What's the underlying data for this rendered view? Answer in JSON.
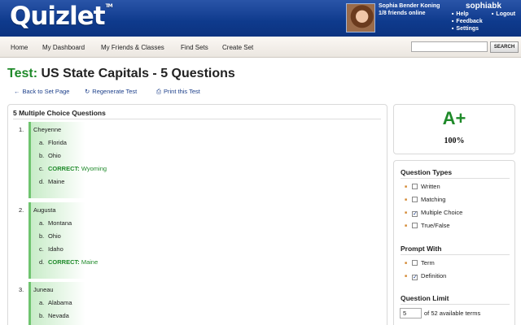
{
  "header": {
    "logo": "Quizlet",
    "tm": "TM",
    "user_full_name": "Sophia Bender Koning",
    "friends_online": "1/8 friends online",
    "username": "sophiabk",
    "links": {
      "help": "Help",
      "logout": "Logout",
      "feedback": "Feedback",
      "settings": "Settings"
    }
  },
  "nav": {
    "items": [
      "Home",
      "My Dashboard",
      "My Friends & Classes",
      "Find Sets",
      "Create Set"
    ],
    "search_value": "",
    "search_button": "SEARCH"
  },
  "page": {
    "title_prefix": "Test:",
    "title": "US State Capitals - 5 Questions",
    "actions": {
      "back": "Back to Set Page",
      "regenerate": "Regenerate Test",
      "print": "Print this Test"
    },
    "section_title": "5 Multiple Choice Questions",
    "questions": [
      {
        "num": "1.",
        "term": "Cheyenne",
        "options": [
          {
            "letter": "a.",
            "text": "Florida"
          },
          {
            "letter": "b.",
            "text": "Ohio"
          },
          {
            "letter": "c.",
            "prefix": "CORRECT:",
            "text": "Wyoming"
          },
          {
            "letter": "d.",
            "text": "Maine"
          }
        ]
      },
      {
        "num": "2.",
        "term": "Augusta",
        "options": [
          {
            "letter": "a.",
            "text": "Montana"
          },
          {
            "letter": "b.",
            "text": "Ohio"
          },
          {
            "letter": "c.",
            "text": "Idaho"
          },
          {
            "letter": "d.",
            "prefix": "CORRECT:",
            "text": "Maine"
          }
        ]
      },
      {
        "num": "3.",
        "term": "Juneau",
        "options": [
          {
            "letter": "a.",
            "text": "Alabama"
          },
          {
            "letter": "b.",
            "text": "Nevada"
          }
        ]
      }
    ]
  },
  "sidebar": {
    "grade": "A+",
    "percent": "100%",
    "question_types_title": "Question Types",
    "question_types": [
      {
        "label": "Written",
        "checked": false
      },
      {
        "label": "Matching",
        "checked": false
      },
      {
        "label": "Multiple Choice",
        "checked": true
      },
      {
        "label": "True/False",
        "checked": false
      }
    ],
    "prompt_with_title": "Prompt With",
    "prompt_with": [
      {
        "label": "Term",
        "checked": false
      },
      {
        "label": "Definition",
        "checked": true
      }
    ],
    "question_limit_title": "Question Limit",
    "question_limit_value": "5",
    "question_limit_text": "of 52 available terms"
  },
  "colors": {
    "header_blue": "#0e3a8c",
    "correct_green": "#1f8a2a",
    "link_blue": "#1c3f8a",
    "bullet_orange": "#d2862f"
  }
}
